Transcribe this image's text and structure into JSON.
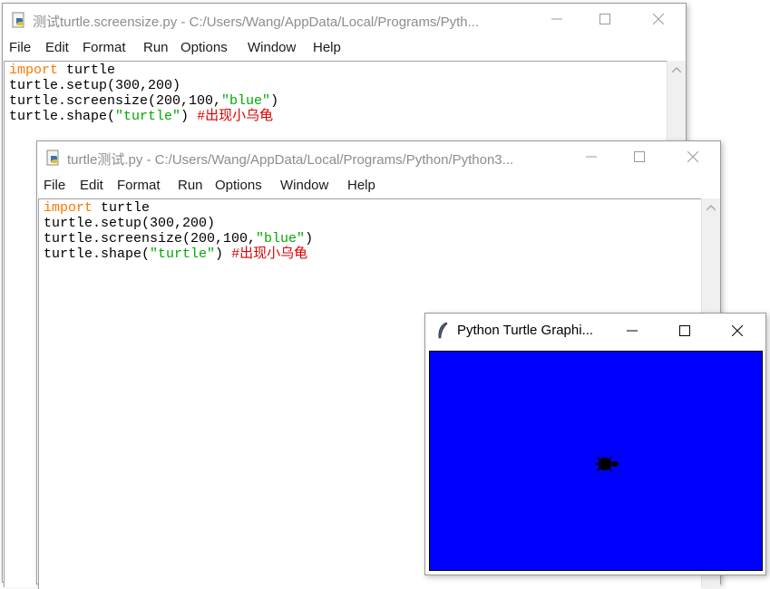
{
  "menu_labels": [
    "File",
    "Edit",
    "Format",
    "Run",
    "Options",
    "Window",
    "Help"
  ],
  "window1": {
    "title": "测试turtle.screensize.py - C:/Users/Wang/AppData/Local/Programs/Pyth...",
    "code_lines": [
      [
        {
          "t": "import",
          "c": "kw"
        },
        {
          "t": " turtle",
          "c": ""
        }
      ],
      [
        {
          "t": "turtle.setup(300,200)",
          "c": ""
        }
      ],
      [
        {
          "t": "turtle.screensize(200,100,",
          "c": ""
        },
        {
          "t": "\"blue\"",
          "c": "str"
        },
        {
          "t": ")",
          "c": ""
        }
      ],
      [
        {
          "t": "turtle.shape(",
          "c": ""
        },
        {
          "t": "\"turtle\"",
          "c": "str"
        },
        {
          "t": ") ",
          "c": ""
        },
        {
          "t": "#出现小乌龟",
          "c": "cmt"
        }
      ]
    ]
  },
  "window2": {
    "title": "turtle测试.py - C:/Users/Wang/AppData/Local/Programs/Python/Python3...",
    "code_lines": [
      [
        {
          "t": "import",
          "c": "kw"
        },
        {
          "t": " turtle",
          "c": ""
        }
      ],
      [
        {
          "t": "turtle.setup(300,200)",
          "c": ""
        }
      ],
      [
        {
          "t": "turtle.screensize(200,100,",
          "c": ""
        },
        {
          "t": "\"blue\"",
          "c": "str"
        },
        {
          "t": ")",
          "c": ""
        }
      ],
      [
        {
          "t": "turtle.shape(",
          "c": ""
        },
        {
          "t": "\"turtle\"",
          "c": "str"
        },
        {
          "t": ") ",
          "c": ""
        },
        {
          "t": "#出现小乌龟",
          "c": "cmt"
        }
      ]
    ]
  },
  "turtle_window": {
    "title": "Python Turtle Graphi...",
    "canvas_color": "#0000ff",
    "turtle_color": "#000000"
  },
  "icons": {
    "minimize": "minimize-icon",
    "maximize": "maximize-icon",
    "close": "close-icon",
    "idle_file": "python-file-icon",
    "feather": "tk-feather-icon"
  }
}
